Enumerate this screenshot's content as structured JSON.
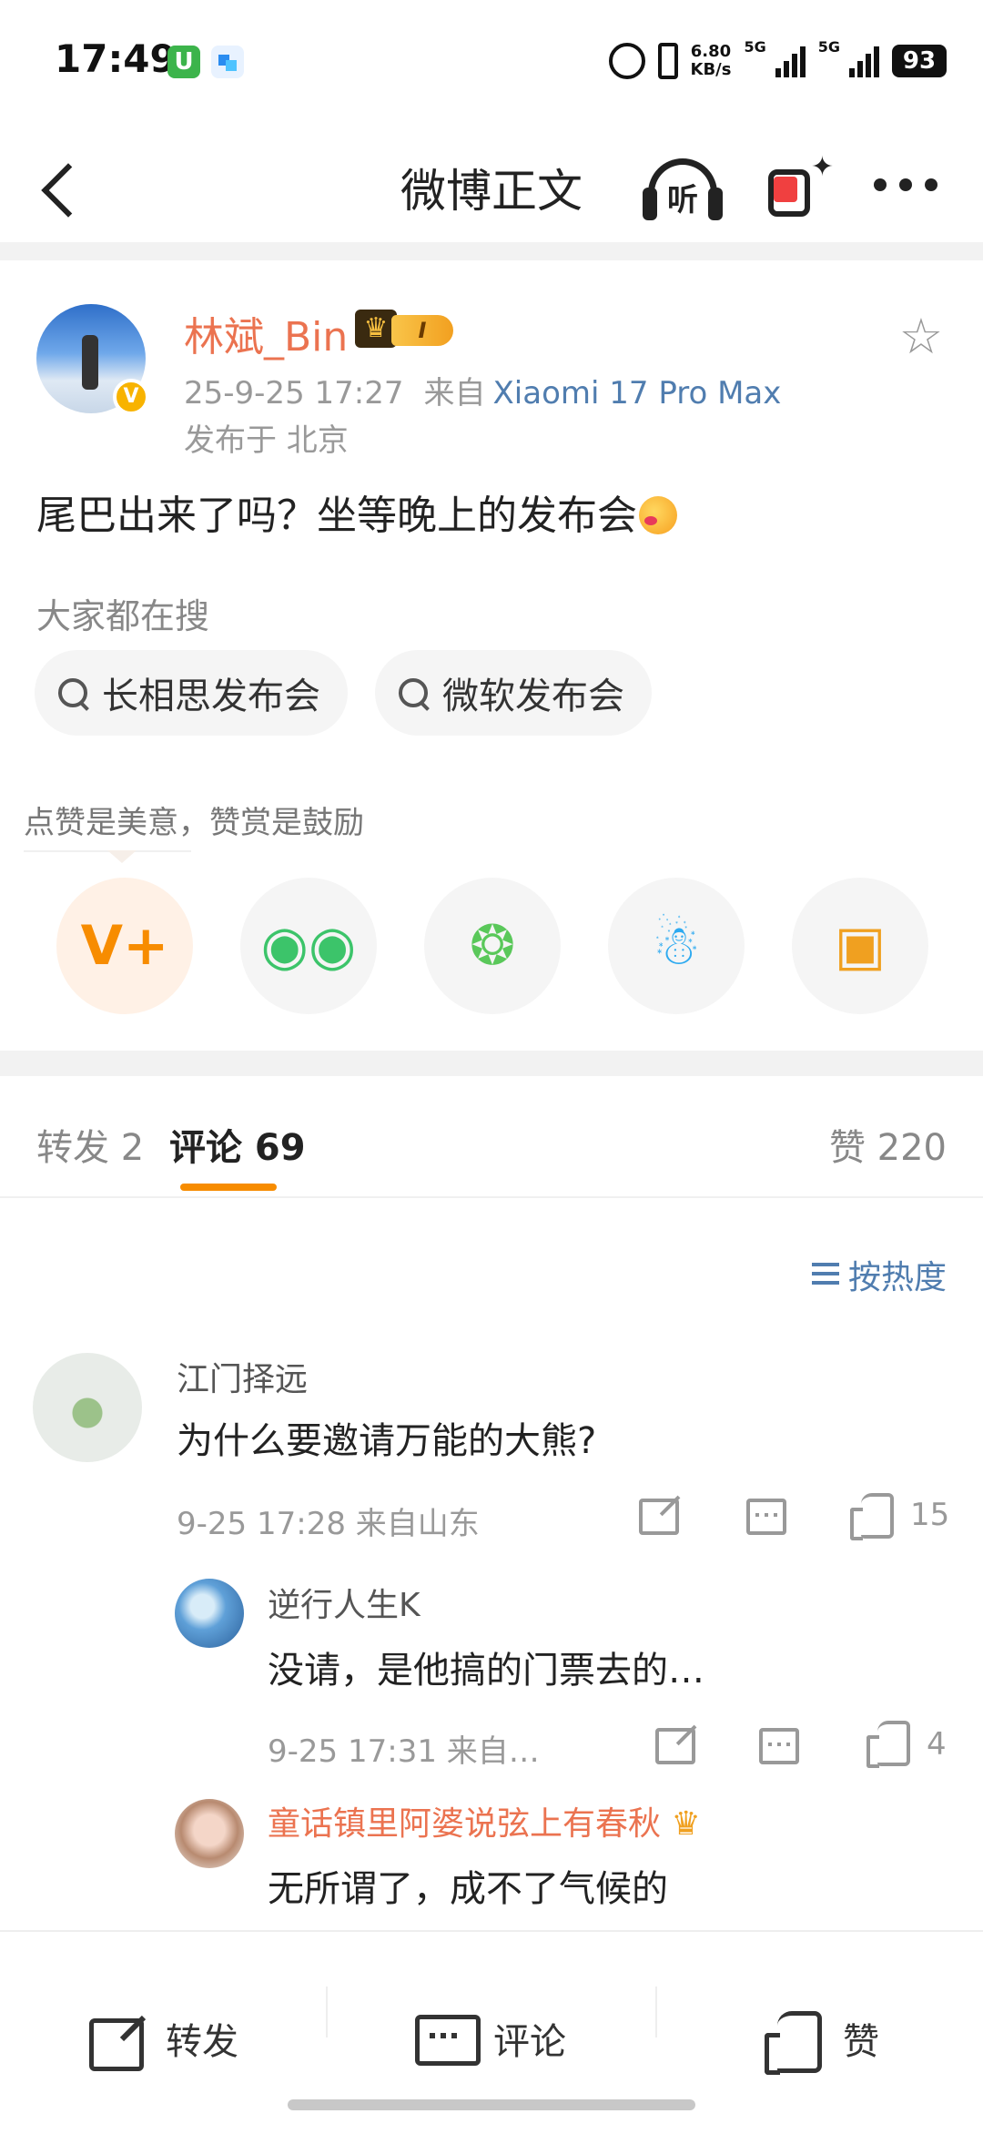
{
  "status_bar": {
    "time": "17:49",
    "net_speed_value": "6.80",
    "net_speed_unit": "KB/s",
    "sim1": "5G",
    "sim2": "5G",
    "battery": "93"
  },
  "header": {
    "title": "微博正文",
    "listen_label": "听",
    "icons": [
      "back-arrow-icon",
      "headphones-listen-icon",
      "gift-sparkle-icon",
      "more-dots-icon"
    ]
  },
  "post": {
    "author": "林斌_Bin",
    "badge_level": "I",
    "date": "25-9-25 17:27",
    "source_label": "来自",
    "device": "Xiaomi 17 Pro Max",
    "location": "发布于 北京",
    "text": "尾巴出来了吗？坐等晚上的发布会"
  },
  "hot_search": {
    "label": "大家都在搜",
    "tags": [
      "长相思发布会",
      "微软发布会"
    ]
  },
  "share": {
    "tip": "点赞是美意，赞赏是鼓励",
    "icons": [
      "reward-v-icon",
      "wechat-icon",
      "moments-icon",
      "qq-icon",
      "save-image-icon"
    ],
    "colors": {
      "reward": "#f78c00",
      "wechat": "#3cc46a",
      "moments": "#5ac85a",
      "qq": "#2eaaf0",
      "image": "#f0a020"
    }
  },
  "tabs": {
    "repost": "转发 2",
    "comments": "评论 69",
    "likes": "赞 220"
  },
  "sort_label": "按热度",
  "comments": [
    {
      "name": "江门择远",
      "text": "为什么要邀请万能的大熊?",
      "meta": "9-25 17:28  来自山东",
      "likes": "15"
    }
  ],
  "replies": [
    {
      "name": "逆行人生K",
      "text": "没请，是他搞的门票去的…",
      "meta": "9-25 17:31  来自…",
      "likes": "4"
    },
    {
      "name": "童话镇里阿婆说弦上有春秋",
      "text": "无所谓了，成不了气候的"
    }
  ],
  "bottom_bar": {
    "repost": "转发",
    "comment": "评论",
    "like": "赞"
  },
  "colors": {
    "accent_orange": "#f78c00",
    "link_blue": "#507daf",
    "name_orange": "#eb7350"
  }
}
